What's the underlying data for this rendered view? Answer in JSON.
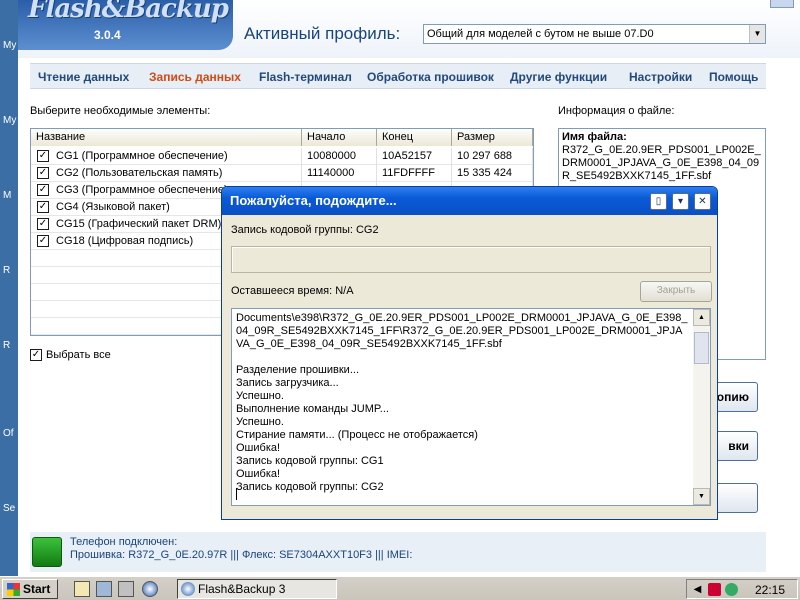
{
  "desktop": {
    "letters": [
      "My",
      "My",
      "M",
      "R",
      "Of",
      "Se",
      "R"
    ]
  },
  "app": {
    "logo": "Flash&Backup",
    "version": "3.0.4",
    "profile_label": "Активный профиль:",
    "profile_value": "Общий для моделей с бутом не выше 07.D0",
    "menu": [
      {
        "label": "Чтение данных",
        "active": false
      },
      {
        "label": "Запись данных",
        "active": true
      },
      {
        "label": "Flash-терминал",
        "active": false
      },
      {
        "label": "Обработка прошивок",
        "active": false
      },
      {
        "label": "Другие функции",
        "active": false
      },
      {
        "label": "Настройки",
        "active": false
      },
      {
        "label": "Помощь",
        "active": false
      }
    ],
    "select_label": "Выберите необходимые элементы:",
    "table": {
      "columns": [
        "Название",
        "Начало",
        "Конец",
        "Размер"
      ],
      "rows": [
        {
          "checked": true,
          "name": "CG1 (Программное обеспечение)",
          "start": "10080000",
          "end": "10A52157",
          "size": "10 297 688"
        },
        {
          "checked": true,
          "name": "CG2 (Пользовательская память)",
          "start": "11140000",
          "end": "11FDFFFF",
          "size": "15 335 424"
        },
        {
          "checked": true,
          "name": "CG3 (Программное обеспечение)",
          "start": "",
          "end": "",
          "size": ""
        },
        {
          "checked": true,
          "name": "CG4 (Языковой пакет)",
          "start": "",
          "end": "",
          "size": ""
        },
        {
          "checked": true,
          "name": "CG15 (Графический пакет DRM)",
          "start": "",
          "end": "",
          "size": ""
        },
        {
          "checked": true,
          "name": "CG18 (Цифровая подпись)",
          "start": "",
          "end": "",
          "size": ""
        }
      ]
    },
    "select_all": {
      "checked": true,
      "label": "Выбрать все"
    },
    "fileinfo": {
      "label": "Информация о файле:",
      "name_label": "Имя файла:",
      "name_value": "R372_G_0E.20.9ER_PDS001_LP002E_DRM0001_JPJAVA_G_0E_E398_04_09R_SE5492BXXK7145_1FF.sbf"
    },
    "side_buttons": [
      "опию",
      "вки"
    ],
    "status": {
      "line1": "Телефон подключен:",
      "line2": "Прошивка: R372_G_0E.20.97R ||| Флекс: SE7304AXXT10F3 ||| IMEI:"
    },
    "accent_color": "#18457a",
    "active_menu_color": "#d14b14"
  },
  "dialog": {
    "title": "Пожалуйста, подождите...",
    "task": "Запись кодовой группы: CG2",
    "remaining": "Оставшееся время: N/A",
    "close_label": "Закрыть",
    "progress": 0,
    "log_path": "Documents\\e398\\R372_G_0E.20.9ER_PDS001_LP002E_DRM0001_JPJAVA_G_0E_E398_04_09R_SE5492BXXK7145_1FF\\R372_G_0E.20.9ER_PDS001_LP002E_DRM0001_JPJAVA_G_0E_E398_04_09R_SE5492BXXK7145_1FF.sbf",
    "log_lines": [
      "Разделение прошивки...",
      "Запись загрузчика...",
      "Успешно.",
      "Выполнение команды JUMP...",
      "Успешно.",
      "Стирание памяти... (Процесс не отображается)",
      "Ошибка!",
      "Запись кодовой группы: CG1",
      "Ошибка!",
      "Запись кодовой группы: CG2"
    ]
  },
  "taskbar": {
    "start_label": "Start",
    "task_app_label": "Flash&Backup 3",
    "clock": "22:15"
  }
}
